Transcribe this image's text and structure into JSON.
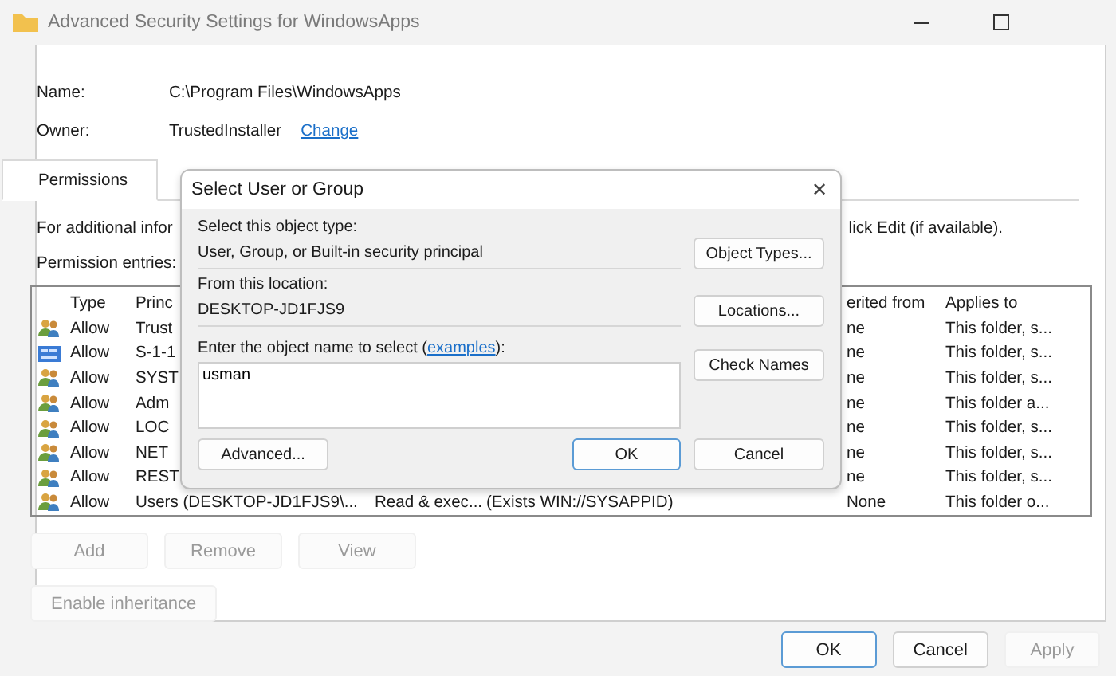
{
  "window": {
    "title": "Advanced Security Settings for WindowsApps"
  },
  "name": {
    "label": "Name:",
    "value": "C:\\Program Files\\WindowsApps"
  },
  "owner": {
    "label": "Owner:",
    "value": "TrustedInstaller",
    "link": "Change"
  },
  "tabs": [
    {
      "label": "Permissions",
      "selected": true
    }
  ],
  "info_left": "For additional infor",
  "info_right": "lick Edit (if available).",
  "entries_label": "Permission entries:",
  "table": {
    "columns": [
      "Type",
      "Princ",
      "erited from",
      "Applies to"
    ],
    "rows": [
      {
        "kind": "group",
        "type": "Allow",
        "principal": "Trust",
        "inherited": "ne",
        "applies_to": "This folder, s..."
      },
      {
        "kind": "sid",
        "type": "Allow",
        "principal": "S-1-1",
        "inherited": "ne",
        "applies_to": "This folder, s..."
      },
      {
        "kind": "group",
        "type": "Allow",
        "principal": "SYST",
        "inherited": "ne",
        "applies_to": "This folder, s..."
      },
      {
        "kind": "group",
        "type": "Allow",
        "principal": "Adm",
        "inherited": "ne",
        "applies_to": "This folder a..."
      },
      {
        "kind": "group",
        "type": "Allow",
        "principal": "LOC",
        "inherited": "ne",
        "applies_to": "This folder, s..."
      },
      {
        "kind": "group",
        "type": "Allow",
        "principal": "NET",
        "inherited": "ne",
        "applies_to": "This folder, s..."
      },
      {
        "kind": "group",
        "type": "Allow",
        "principal": "REST",
        "inherited": "ne",
        "applies_to": "This folder, s..."
      },
      {
        "kind": "group",
        "type": "Allow",
        "principal": "Users (DESKTOP-JD1FJS9\\...",
        "access": "Read & exec...",
        "condition": "(Exists WIN://SYSAPPID)",
        "inherited": "None",
        "applies_to": "This folder o..."
      }
    ]
  },
  "entry_buttons": [
    {
      "label": "Add",
      "disabled": true
    },
    {
      "label": "Remove",
      "disabled": true
    },
    {
      "label": "View",
      "disabled": true
    }
  ],
  "inheritance_button": {
    "label": "Enable inheritance",
    "disabled": true
  },
  "footer_buttons": [
    {
      "label": "OK",
      "disabled": false,
      "default": true
    },
    {
      "label": "Cancel",
      "disabled": false,
      "default": false
    },
    {
      "label": "Apply",
      "disabled": true,
      "default": false
    }
  ],
  "dialog": {
    "title": "Select User or Group",
    "close": "✕",
    "object_type": {
      "label": "Select this object type:",
      "value": "User, Group, or Built-in security principal",
      "button": "Object Types..."
    },
    "location": {
      "label": "From this location:",
      "value": "DESKTOP-JD1FJS9",
      "button": "Locations..."
    },
    "name_entry": {
      "label": "Enter the object name to select (",
      "link": "examples",
      "label_end": "):",
      "value": "usman",
      "button": "Check Names"
    },
    "advanced_button": "Advanced...",
    "buttons": [
      {
        "label": "OK",
        "default": true
      },
      {
        "label": "Cancel",
        "default": false
      }
    ]
  }
}
